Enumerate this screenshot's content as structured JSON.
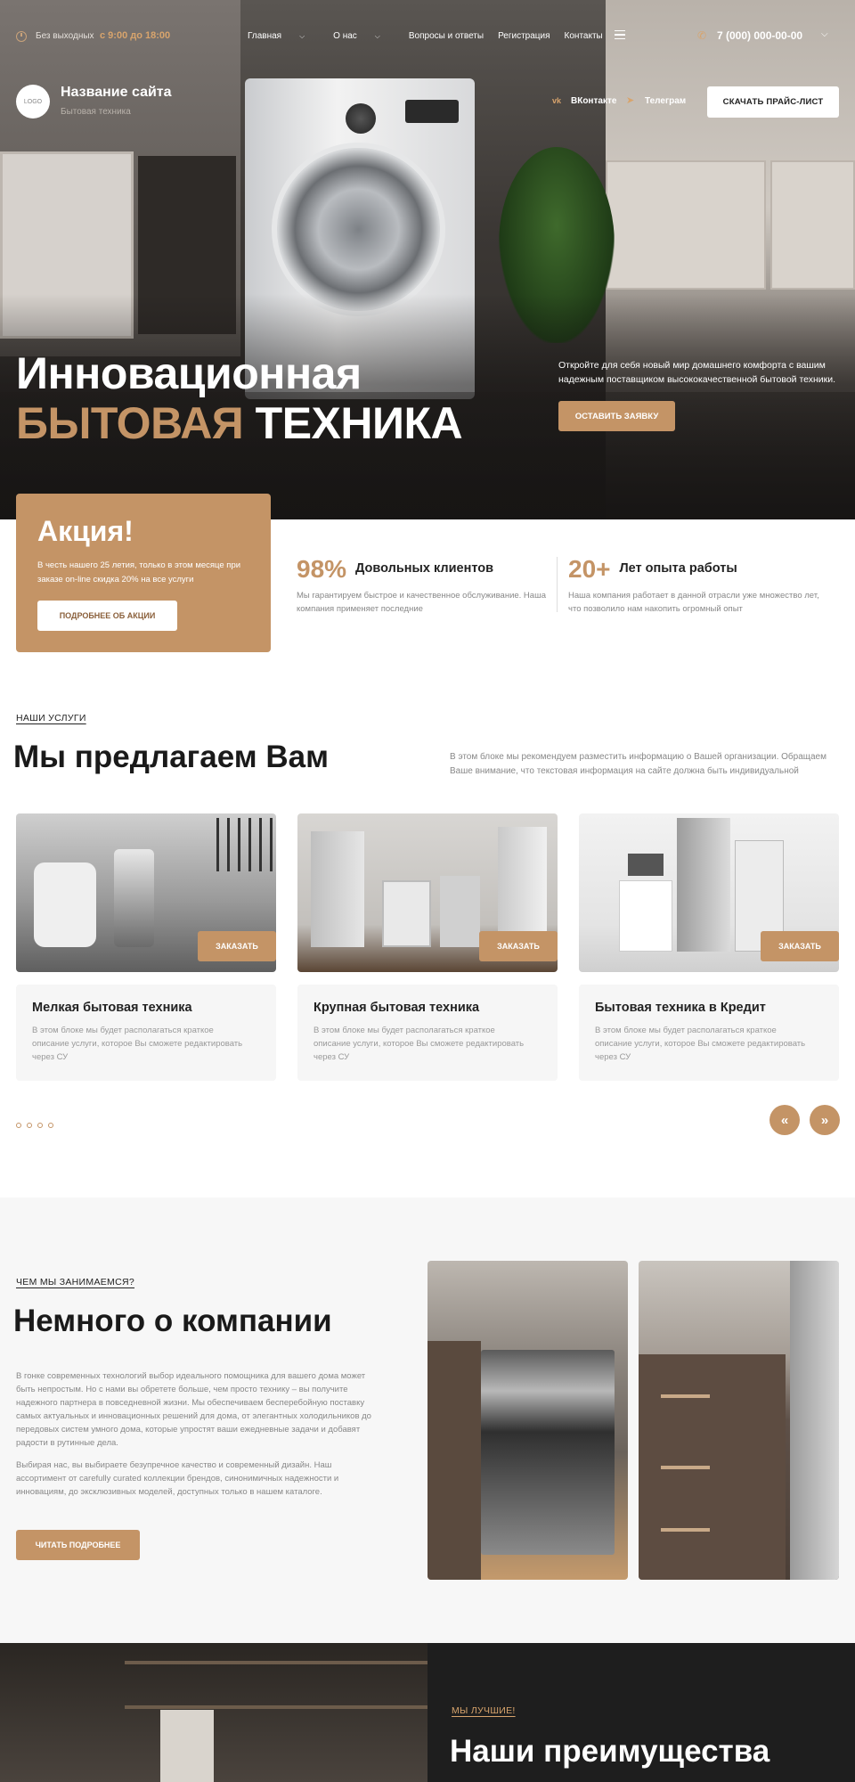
{
  "topbar": {
    "weekend": "Без выходных",
    "hours": "с 9:00 до 18:00",
    "nav": [
      {
        "label": "Главная",
        "dropdown": true
      },
      {
        "label": "О нас",
        "dropdown": true
      },
      {
        "label": "Вопросы и ответы",
        "dropdown": false
      },
      {
        "label": "Регистрация",
        "dropdown": false
      },
      {
        "label": "Контакты",
        "dropdown": false
      }
    ],
    "phone": "7 (000) 000-00-00"
  },
  "brand": {
    "logo_text": "LOGO",
    "name": "Название сайта",
    "tagline": "Бытовая техника"
  },
  "social": {
    "vk": "ВКонтакте",
    "telegram": "Телеграм"
  },
  "header": {
    "price_button": "СКАЧАТЬ ПРАЙС-ЛИСТ"
  },
  "hero": {
    "title_line1": "Инновационная",
    "title_accent": "БЫТОВАЯ",
    "title_rest": "ТЕХНИКА",
    "description": "Откройте для себя новый мир домашнего комфорта с вашим надежным поставщиком высококачественной бытовой техники.",
    "cta": "ОСТАВИТЬ ЗАЯВКУ"
  },
  "promo": {
    "title": "Акция!",
    "text": "В честь нашего 25 летия, только в этом месяце при заказе on-line скидка 20% на все услуги",
    "button": "ПОДРОБНЕЕ ОБ АКЦИИ"
  },
  "stats": [
    {
      "value": "98%",
      "label": "Довольных клиентов",
      "text": "Мы гарантируем быстрое и качественное обслуживание. Наша компания применяет последние"
    },
    {
      "value": "20+",
      "label": "Лет опыта работы",
      "text": "Наша компания работает в данной отрасли уже множество лет, что позволило нам накопить огромный опыт"
    }
  ],
  "services": {
    "eyebrow": "НАШИ УСЛУГИ",
    "title": "Мы предлагаем Вам",
    "description": "В этом блоке мы рекомендуем разместить информацию о Вашей организации. Обращаем Ваше внимание,  что текстовая информация на сайте должна быть индивидуальной",
    "order_label": "ЗАКАЗАТЬ",
    "items": [
      {
        "title": "Мелкая бытовая техника",
        "text": "В этом блоке мы будет располагаться краткое описание услуги, которое Вы сможете редактировать через СУ"
      },
      {
        "title": "Крупная бытовая техника",
        "text": "В этом блоке мы будет располагаться краткое описание услуги, которое Вы сможете редактировать через СУ"
      },
      {
        "title": "Бытовая техника в Кредит",
        "text": "В этом блоке мы будет располагаться краткое описание услуги, которое Вы сможете редактировать через СУ"
      }
    ],
    "prev": "«",
    "next": "»"
  },
  "about": {
    "eyebrow": "ЧЕМ МЫ ЗАНИМАЕМСЯ?",
    "title": "Немного о компании",
    "p1": "В гонке современных технологий выбор идеального помощника для вашего дома может быть непростым. Но с нами вы обретете больше, чем просто технику – вы получите надежного партнера в повседневной жизни. Мы обеспечиваем бесперебойную поставку самых актуальных и инновационных решений для дома, от элегантных холодильников до передовых систем умного дома, которые упростят ваши ежедневные задачи и добавят радости в рутинные дела.",
    "p2": "Выбирая нас, вы выбираете безупречное качество и современный дизайн. Наш ассортимент от carefully curated коллекции брендов, синонимичных надежности и инновациям, до эксклюзивных моделей, доступных только в нашем каталоге.",
    "button": "ЧИТАТЬ ПОДРОБНЕЕ"
  },
  "advantages": {
    "eyebrow": "МЫ ЛУЧШИЕ!",
    "title": "Наши преимущества"
  },
  "colors": {
    "accent": "#c49466",
    "dark": "#1e1e1e",
    "light_bg": "#f7f7f7"
  }
}
